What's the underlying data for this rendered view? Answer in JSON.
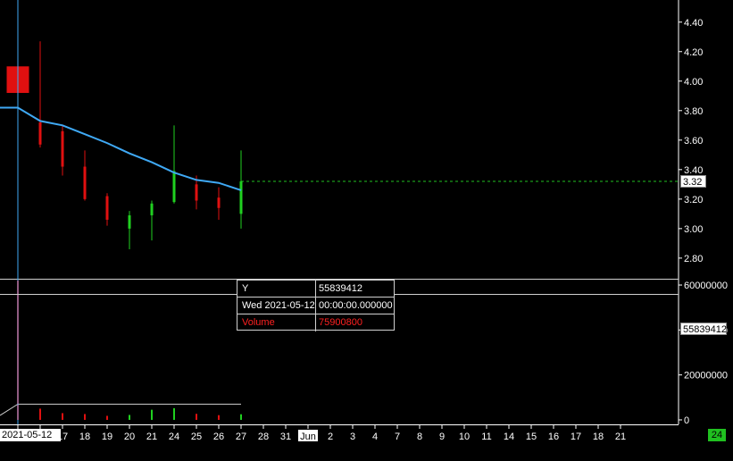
{
  "chart_data": [
    {
      "type": "candlestick",
      "x_labels": [
        "2021-05-12",
        "4",
        "17",
        "18",
        "19",
        "20",
        "21",
        "24",
        "25",
        "26",
        "27",
        "28",
        "31",
        "Jun",
        "2",
        "3",
        "4",
        "7",
        "8",
        "9",
        "10",
        "11",
        "14",
        "15",
        "16",
        "17",
        "18",
        "21"
      ],
      "y_ticks": [
        2.8,
        3.0,
        3.2,
        3.4,
        3.6,
        3.8,
        4.0,
        4.2,
        4.4
      ],
      "y_tick_labels": [
        "2.80",
        "3.00",
        "3.20",
        "3.40",
        "3.60",
        "3.80",
        "4.00",
        "4.20",
        "4.40"
      ],
      "ylim": [
        2.66,
        4.55
      ],
      "candles": [
        {
          "date": "2021-05-12",
          "open": 4.1,
          "high": 4.1,
          "low": 3.92,
          "close": 3.92
        },
        {
          "date": "2021-05-13",
          "open": 3.72,
          "high": 4.27,
          "low": 3.55,
          "close": 3.57
        },
        {
          "date": "2021-05-14",
          "open": 3.66,
          "high": 3.7,
          "low": 3.36,
          "close": 3.42
        },
        {
          "date": "2021-05-17",
          "open": 3.42,
          "high": 3.53,
          "low": 3.19,
          "close": 3.2
        },
        {
          "date": "2021-05-18",
          "open": 3.22,
          "high": 3.24,
          "low": 3.02,
          "close": 3.06
        },
        {
          "date": "2021-05-19",
          "open": 3.0,
          "high": 3.12,
          "low": 2.86,
          "close": 3.09
        },
        {
          "date": "2021-05-20",
          "open": 3.09,
          "high": 3.19,
          "low": 2.92,
          "close": 3.17
        },
        {
          "date": "2021-05-21",
          "open": 3.18,
          "high": 3.7,
          "low": 3.17,
          "close": 3.39
        },
        {
          "date": "2021-05-24",
          "open": 3.3,
          "high": 3.36,
          "low": 3.13,
          "close": 3.19
        },
        {
          "date": "2021-05-25",
          "open": 3.21,
          "high": 3.28,
          "low": 3.06,
          "close": 3.14
        },
        {
          "date": "2021-05-26",
          "open": 3.1,
          "high": 3.53,
          "low": 3.0,
          "close": 3.32
        }
      ],
      "moving_average": {
        "color": "#3fa9f5",
        "values": [
          3.82,
          3.73,
          3.7,
          3.64,
          3.58,
          3.51,
          3.45,
          3.38,
          3.33,
          3.31,
          3.26
        ]
      },
      "last_price": 3.32,
      "last_price_label": "3.32",
      "colors": {
        "up": "#20d020",
        "down": "#e01010",
        "last_price_line": "#20c020"
      }
    },
    {
      "type": "bar",
      "series_name": "Volume",
      "y_ticks": [
        0,
        20000000,
        40000000,
        60000000
      ],
      "y_tick_labels": [
        "0",
        "20000000",
        "40000000",
        "60000000"
      ],
      "ylim": [
        -2000000,
        62000000
      ],
      "values": [
        75900800,
        5000000,
        3000000,
        2600000,
        1800000,
        2200000,
        4500000,
        5200000,
        2700000,
        2100000,
        2500000
      ],
      "colors": {
        "up": "#20d020",
        "down": "#e01010"
      },
      "crosshair_value": 55839412,
      "crosshair_label": "55839412"
    }
  ],
  "tooltip": {
    "y_label": "Y",
    "y_value": "55839412",
    "date_label": "Wed 2021-05-12",
    "time_value": "00:00:00.000000",
    "series_label": "Volume",
    "series_value": "75900800"
  },
  "cursor_date_label": "2021-05-12",
  "corner_badge": "24",
  "colors": {
    "background": "#000000",
    "axis": "#ffffff",
    "crosshair": "#3fa9f5",
    "panel_divider": "#d0d0d0"
  }
}
